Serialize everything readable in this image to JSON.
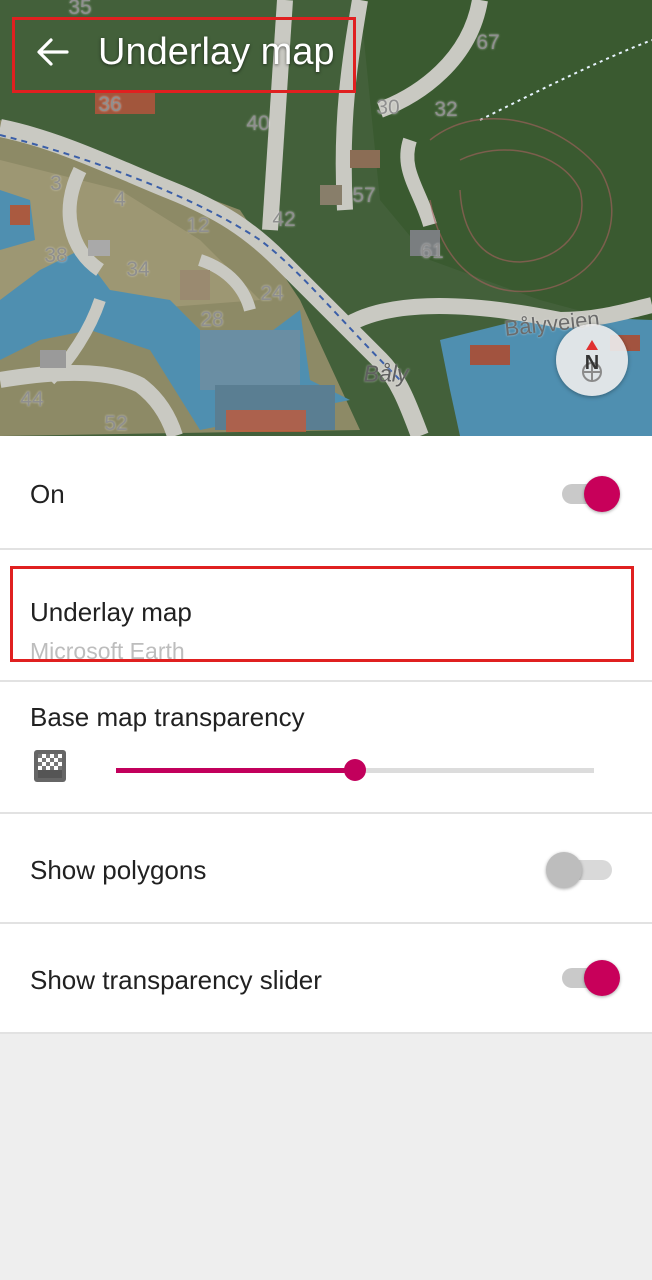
{
  "header": {
    "title": "Underlay map"
  },
  "map": {
    "labels": [
      {
        "text": "35"
      },
      {
        "text": "67"
      },
      {
        "text": "36"
      },
      {
        "text": "30"
      },
      {
        "text": "32"
      },
      {
        "text": "40"
      },
      {
        "text": "3"
      },
      {
        "text": "4"
      },
      {
        "text": "57"
      },
      {
        "text": "12"
      },
      {
        "text": "42"
      },
      {
        "text": "61"
      },
      {
        "text": "38"
      },
      {
        "text": "34"
      },
      {
        "text": "24"
      },
      {
        "text": "28"
      },
      {
        "text": "44"
      },
      {
        "text": "52"
      }
    ],
    "place": "Båly",
    "road": "Bålyveien",
    "compass_letter": "N"
  },
  "settings": {
    "on": {
      "label": "On",
      "enabled": true
    },
    "underlay": {
      "label": "Underlay map",
      "value": "Microsoft Earth"
    },
    "transparency": {
      "label": "Base map transparency",
      "value_percent": 50
    },
    "polygons": {
      "label": "Show polygons",
      "enabled": false
    },
    "slider_toggle": {
      "label": "Show transparency slider",
      "enabled": true
    }
  },
  "colors": {
    "accent": "#c8005a",
    "highlight": "#e02020"
  }
}
